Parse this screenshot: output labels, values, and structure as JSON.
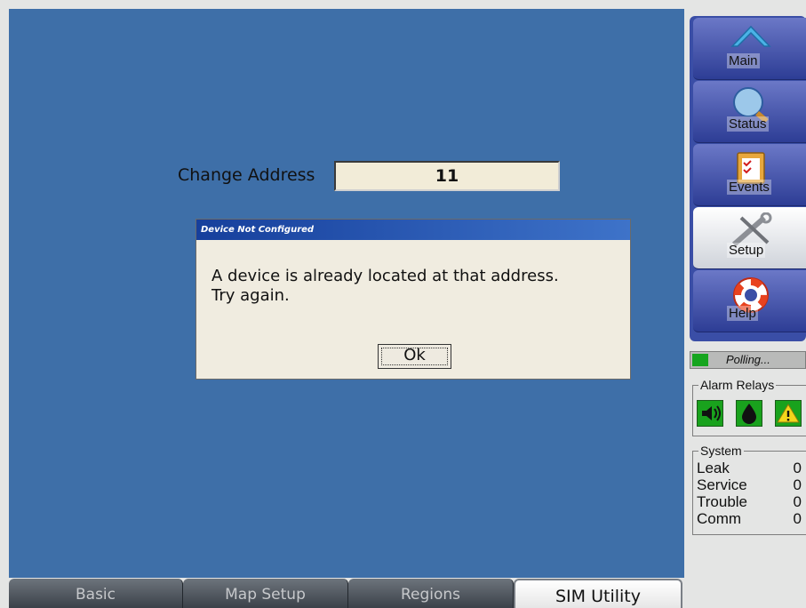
{
  "main": {
    "change_address_label": "Change Address",
    "address_value": "11"
  },
  "dialog": {
    "title": "Device Not Configured",
    "message_line1": "A device is already located at that address.",
    "message_line2": "Try again.",
    "ok_label": "Ok"
  },
  "tabs": [
    {
      "label": "Basic"
    },
    {
      "label": "Map Setup"
    },
    {
      "label": "Regions"
    },
    {
      "label": "SIM Utility",
      "active": true
    }
  ],
  "sidebar": {
    "items": [
      {
        "label": "Main",
        "icon": "home-icon"
      },
      {
        "label": "Status",
        "icon": "magnifier-icon"
      },
      {
        "label": "Events",
        "icon": "clipboard-icon"
      },
      {
        "label": "Setup",
        "icon": "tools-icon",
        "active": true
      },
      {
        "label": "Help",
        "icon": "lifebuoy-icon"
      }
    ]
  },
  "status": {
    "polling_text": "Polling...",
    "indicator_color": "#16a51f"
  },
  "alarm_relays": {
    "legend": "Alarm Relays",
    "icons": [
      "speaker-icon",
      "drop-icon",
      "warning-icon"
    ]
  },
  "system": {
    "legend": "System",
    "rows": [
      {
        "label": "Leak",
        "value": "0"
      },
      {
        "label": "Service",
        "value": "0"
      },
      {
        "label": "Trouble",
        "value": "0"
      },
      {
        "label": "Comm",
        "value": "0"
      }
    ]
  },
  "colors": {
    "background_blue": "#3e6fa8",
    "dialog_title": "#163f9c",
    "sidebar": "#3a4ea6"
  }
}
